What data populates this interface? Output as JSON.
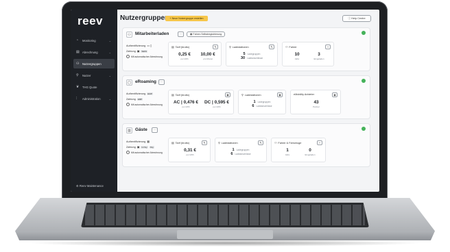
{
  "app": {
    "logo": "reev"
  },
  "sidebar": {
    "items": [
      {
        "label": "Monitoring",
        "icon": "gauge-icon"
      },
      {
        "label": "Abrechnung",
        "icon": "receipt-icon"
      },
      {
        "label": "Nutzergruppen",
        "icon": "users-icon",
        "active": true
      },
      {
        "label": "Nutzer",
        "icon": "user-icon"
      },
      {
        "label": "THG Quote",
        "icon": "leaf-icon"
      },
      {
        "label": "Administration",
        "icon": "sliders-icon"
      }
    ],
    "footer": "Reev Maintenance"
  },
  "header": {
    "title": "Nutzergruppen",
    "create_label": "Neue Nutzergruppe erstellen",
    "help_label": "Help Centre"
  },
  "groups": [
    {
      "name": "Mitarbeiterladen",
      "chip": "Fahrer-Selbstregistrierung",
      "auth_label": "Authentifizierung",
      "payment_label": "Zahlung",
      "payment_badge": "SEPA",
      "auto_label": "Mit automatischer Abrechnung",
      "tarif": {
        "title": "Tarif (brutto)",
        "v1": "0,25 €",
        "k1": "per kWh",
        "v2": "10,00 €",
        "k2": "pro Monat"
      },
      "stations": {
        "title": "Ladestationen",
        "n1": "5",
        "l1": "Ladegruppen",
        "n2": "30",
        "l2": "Ladeanschlüsse"
      },
      "drivers": {
        "title": "Fahrer",
        "v1": "10",
        "k1": "Aktiv",
        "v2": "3",
        "k2": "Eingeladen"
      }
    },
    {
      "name": "eRoaming",
      "auth_label": "Authentifizierung",
      "auth_badge": "EMP",
      "payment_label": "Zahlung",
      "payment_badge": "EMP",
      "auto_label": "Mit automatischer Abrechnung",
      "tarif": {
        "title": "Tarif (brutto)",
        "v1": "AC | 0,476 €",
        "k1": "per kWh",
        "v2": "DC | 0,595 €",
        "k2": "per kWh"
      },
      "stations": {
        "title": "Ladestationen",
        "n1": "1",
        "l1": "Ladegruppen",
        "n2": "6",
        "l2": "Ladeanschlüsse"
      },
      "emobility": {
        "title": "eMobility Anbieter",
        "v1": "43",
        "k1": "Partner"
      }
    },
    {
      "name": "Gäste",
      "auth_label": "Authentifizierung",
      "payment_label": "Zahlung",
      "payment_badges": [
        "G Pay",
        "Pay"
      ],
      "auto_label": "Mit automatischer Abrechnung",
      "tarif": {
        "title": "Tarif (brutto)",
        "v1": "0,31 €",
        "k1": "per kWh"
      },
      "stations": {
        "title": "Ladestationen",
        "n1": "1",
        "l1": "Ladegruppen",
        "n2": "6",
        "l2": "Ladeanschlüsse"
      },
      "drivers": {
        "title": "Fahrer & Fahrzeuge",
        "v1": "1",
        "k1": "Aktiv",
        "v2": "0",
        "k2": "Eingeladen"
      }
    }
  ],
  "colors": {
    "accent": "#f6c64a",
    "sidebar": "#1e2126",
    "status_green": "#45b25a"
  }
}
